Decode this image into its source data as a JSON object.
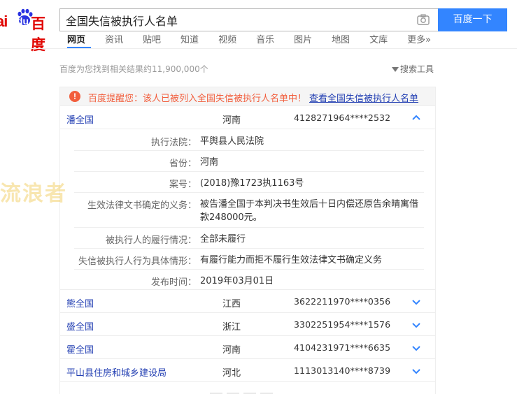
{
  "logo": {
    "part1": "ai",
    "du": "du",
    "part2": "百度"
  },
  "search": {
    "query": "全国失信被执行人名单",
    "button": "百度一下"
  },
  "nav": {
    "tabs": [
      "网页",
      "资讯",
      "贴吧",
      "知道",
      "视频",
      "音乐",
      "图片",
      "地图",
      "文库",
      "更多»"
    ]
  },
  "result_count": "百度为您找到相关结果约11,900,000个",
  "tools": "搜索工具",
  "alert": {
    "icon": "!",
    "text": "百度提醒您：该人已被列入全国失信被执行人名单中！",
    "link": "查看全国失信被执行人名单"
  },
  "rows": [
    {
      "name": "潘全国",
      "province": "河南",
      "id": "4128271964****2532",
      "expanded": true
    },
    {
      "name": "熊全国",
      "province": "江西",
      "id": "3622211970****0356",
      "expanded": false
    },
    {
      "name": "盛全国",
      "province": "浙江",
      "id": "3302251954****1576",
      "expanded": false
    },
    {
      "name": "霍全国",
      "province": "河南",
      "id": "4104231971****6635",
      "expanded": false
    },
    {
      "name": "平山县住房和城乡建设局",
      "province": "河北",
      "id": "1113013140****8739",
      "expanded": false
    }
  ],
  "details": [
    {
      "label": "执行法院：",
      "value": "平舆县人民法院"
    },
    {
      "label": "省份：",
      "value": "河南"
    },
    {
      "label": "案号：",
      "value": "(2018)豫1723执1163号"
    },
    {
      "label": "生效法律文书确定的义务：",
      "value": "被告潘全国于本判决书生效后十日内偿还原告余晴寓借款248000元。"
    },
    {
      "label": "被执行人的履行情况：",
      "value": "全部未履行"
    },
    {
      "label": "失信被执行人行为具体情形：",
      "value": "有履行能力而拒不履行生效法律文书确定义务"
    },
    {
      "label": "发布时间：",
      "value": "2019年03月01日"
    }
  ],
  "watermark": "流浪者",
  "colors": {
    "link": "#2440b3",
    "accent": "#3385ff",
    "alert": "#f25e3d",
    "logo": "#e10602"
  }
}
